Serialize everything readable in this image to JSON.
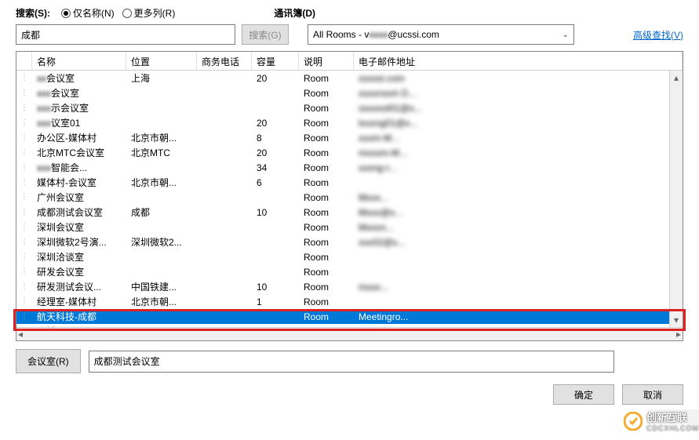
{
  "labels": {
    "search": "搜索(S):",
    "name_only": "仅名称(N)",
    "more_columns": "更多列(R)",
    "addressbook": "通讯簿(D)",
    "search_btn": "搜索(G)",
    "advanced": "高级查找(V)",
    "rooms_btn": "会议室(R)",
    "ok": "确定",
    "cancel": "取消"
  },
  "search_value": "成都",
  "dropdown_prefix": "All Rooms - v",
  "dropdown_suffix": "@ucssi.com",
  "columns": {
    "name": "名称",
    "location": "位置",
    "phone": "商务电话",
    "capacity": "容量",
    "desc": "说明",
    "email": "电子邮件地址"
  },
  "rows": [
    {
      "name_blur": "xx",
      "name": "会议室",
      "loc": "上海",
      "cap": "20",
      "desc": "Room",
      "email": "xxxxsi.com"
    },
    {
      "name_blur": "xxx",
      "name": "会议室",
      "loc": "",
      "cap": "",
      "desc": "Room",
      "email": "xxxxroom D..."
    },
    {
      "name_blur": "xxx",
      "name": "示会议室",
      "loc": "",
      "cap": "",
      "desc": "Room",
      "email": "sxxxxst01@x..."
    },
    {
      "name_blur": "xxx",
      "name": "议室01",
      "loc": "",
      "cap": "20",
      "desc": "Room",
      "email": "lxxxng01@x..."
    },
    {
      "name": "办公区-媒体村",
      "loc": "北京市朝...",
      "cap": "8",
      "desc": "Room",
      "email": "xxxm-M..."
    },
    {
      "name": "北京MTC会议室",
      "loc": "北京MTC",
      "cap": "20",
      "desc": "Room",
      "email": "mxxxm-M..."
    },
    {
      "name_blur": "xxx",
      "name": "智能会...",
      "loc": "",
      "cap": "34",
      "desc": "Room",
      "email": "xxxng-r..."
    },
    {
      "name": "媒体村-会议室",
      "loc": "北京市朝...",
      "cap": "6",
      "desc": "Room",
      "email": ""
    },
    {
      "name": "广州会议室",
      "loc": "",
      "cap": "",
      "desc": "Room",
      "email": "Mxxx..."
    },
    {
      "name": "成都测试会议室",
      "loc": "成都",
      "cap": "10",
      "desc": "Room",
      "email": "Mxxx@x..."
    },
    {
      "name": "深圳会议室",
      "loc": "",
      "cap": "",
      "desc": "Room",
      "email": "Mxxxn..."
    },
    {
      "name": "深圳微软2号演...",
      "loc": "深圳微软2...",
      "cap": "",
      "desc": "Room",
      "email": "xxx02@x..."
    },
    {
      "name": "深圳洽谈室",
      "loc": "",
      "cap": "",
      "desc": "Room",
      "email": ""
    },
    {
      "name": "研发会议室",
      "loc": "",
      "cap": "",
      "desc": "Room",
      "email": ""
    },
    {
      "name": "研发测试会议...",
      "loc": "中国铁建...",
      "cap": "10",
      "desc": "Room",
      "email": "mxxx..."
    },
    {
      "name": "经理室-媒体村",
      "loc": "北京市朝...",
      "cap": "1",
      "desc": "Room",
      "email": ""
    },
    {
      "name": "航天科技-成都",
      "loc": "",
      "cap": "",
      "desc": "Room",
      "email": "Meetingro...",
      "selected": true,
      "noblur": true
    },
    {
      "name": "青城山",
      "loc": "",
      "cap": "",
      "desc": "Room",
      "email": "mxxx-qc..."
    }
  ],
  "selected_room": "成都测试会议室",
  "watermark": {
    "brand": "创新互联",
    "sub": "CDCXHLCOM"
  }
}
